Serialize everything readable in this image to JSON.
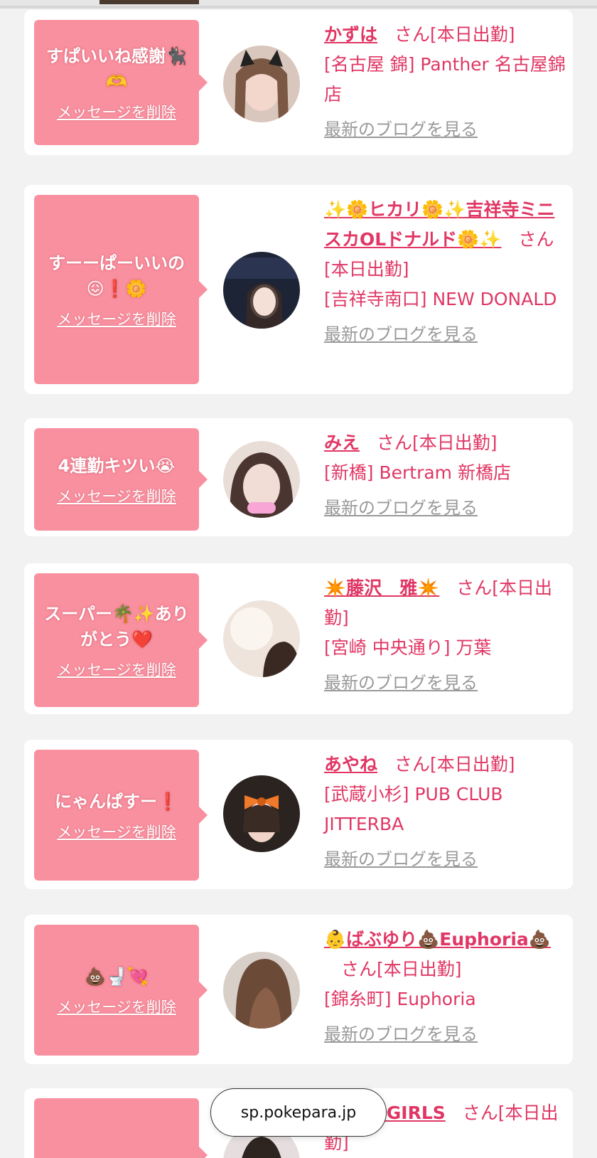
{
  "url": "sp.pokepara.jp",
  "delete_label": "メッセージを削除",
  "blog_label": "最新のブログを見る",
  "cards": [
    {
      "message": "すぱいいね感謝🐈‍⬛🫶",
      "name": "かずは",
      "san": "さん[本日出勤]",
      "shop": "[名古屋 錦] Panther 名古屋錦店"
    },
    {
      "message": "すーーぱーいいの😖❗️🌼",
      "name": "✨🌼ヒカリ🌼✨吉祥寺ミニスカOLドナルド🌼✨",
      "san": "さん[本日出勤]",
      "shop": "[吉祥寺南口] NEW DONALD"
    },
    {
      "message": "4連勤キツい😭",
      "name": "みえ",
      "san": "さん[本日出勤]",
      "shop": "[新橋] Bertram 新橋店"
    },
    {
      "message": "スーパー🌴✨ありがとう❤️",
      "name": "✴️藤沢　雅✴️",
      "san": "さん[本日出勤]",
      "shop": "[宮崎 中央通り] 万葉"
    },
    {
      "message": "にゃんぱすー❗️",
      "name": "あやね",
      "san": "さん[本日出勤]",
      "shop": "[武蔵小杉] PUB CLUB JITTERBA"
    },
    {
      "message": "💩🚽💘",
      "name": "👶ばぶゆり💩Euphoria💩",
      "san": "さん[本日出勤]",
      "shop": "[錦糸町] Euphoria"
    },
    {
      "message": "🌸",
      "name": "🌟TOPGIRLS",
      "san": "さん[本日出勤]",
      "shop": ""
    }
  ],
  "colors": {
    "bubble": "#f9909f",
    "accent": "#e03764",
    "link_gray": "#999999"
  }
}
